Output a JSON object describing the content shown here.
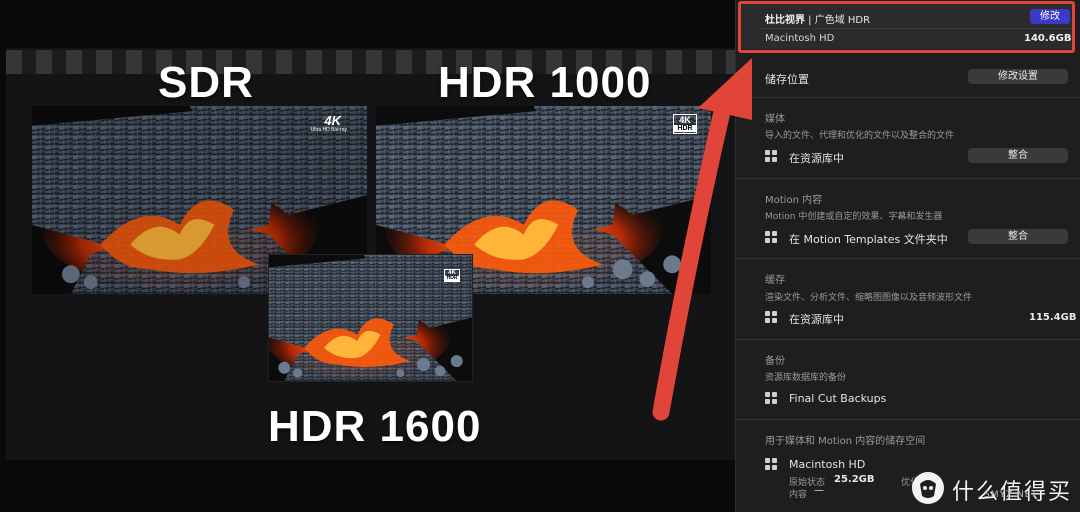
{
  "viewer": {
    "labels": {
      "sdr": "SDR",
      "hdr1000": "HDR 1000",
      "hdr1600": "HDR 1600"
    },
    "badges": {
      "sdr_4k": "4K",
      "sdr_sub": "Ultra HD Blu-ray",
      "hdr1000_4k": "4K",
      "hdr1000_hdr": "HDR",
      "hdr1600_4k": "4K",
      "hdr1600_hdr": "HDR"
    }
  },
  "panel": {
    "display": {
      "name": "杜比视界",
      "separator": " | ",
      "mode": "广色域 HDR",
      "edit_label": "修改"
    },
    "disk": {
      "name": "Macintosh HD",
      "size": "140.6GB"
    },
    "storage_location": {
      "label": "储存位置",
      "button": "修改设置"
    },
    "media": {
      "title": "媒体",
      "desc": "导入的文件、代理和优化的文件以及整合的文件",
      "location": "在资源库中",
      "button": "整合"
    },
    "motion": {
      "title": "Motion 内容",
      "desc": "Motion 中创建或自定的效果、字幕和发生器",
      "location": "在 Motion Templates 文件夹中",
      "button": "整合"
    },
    "cache": {
      "title": "缓存",
      "desc": "渲染文件、分析文件、缩略图图像以及音频波形文件",
      "location": "在资源库中",
      "size": "115.4GB"
    },
    "backup": {
      "title": "备份",
      "desc": "资源库数据库的备份",
      "location": "Final Cut Backups"
    },
    "space": {
      "title": "用于媒体和 Motion 内容的储存空间",
      "disk": "Macintosh HD",
      "original_label": "原始状态",
      "original_value": "25.2GB",
      "content_label": "内容",
      "content_value": "—",
      "right_label": "优化"
    }
  },
  "watermark": {
    "text": "什么值得买",
    "sub": "SMYZ.NET"
  },
  "colors": {
    "accent_purple": "#3b39c8",
    "highlight_red": "#e1453a",
    "panel_bg": "#1e1e1f"
  }
}
